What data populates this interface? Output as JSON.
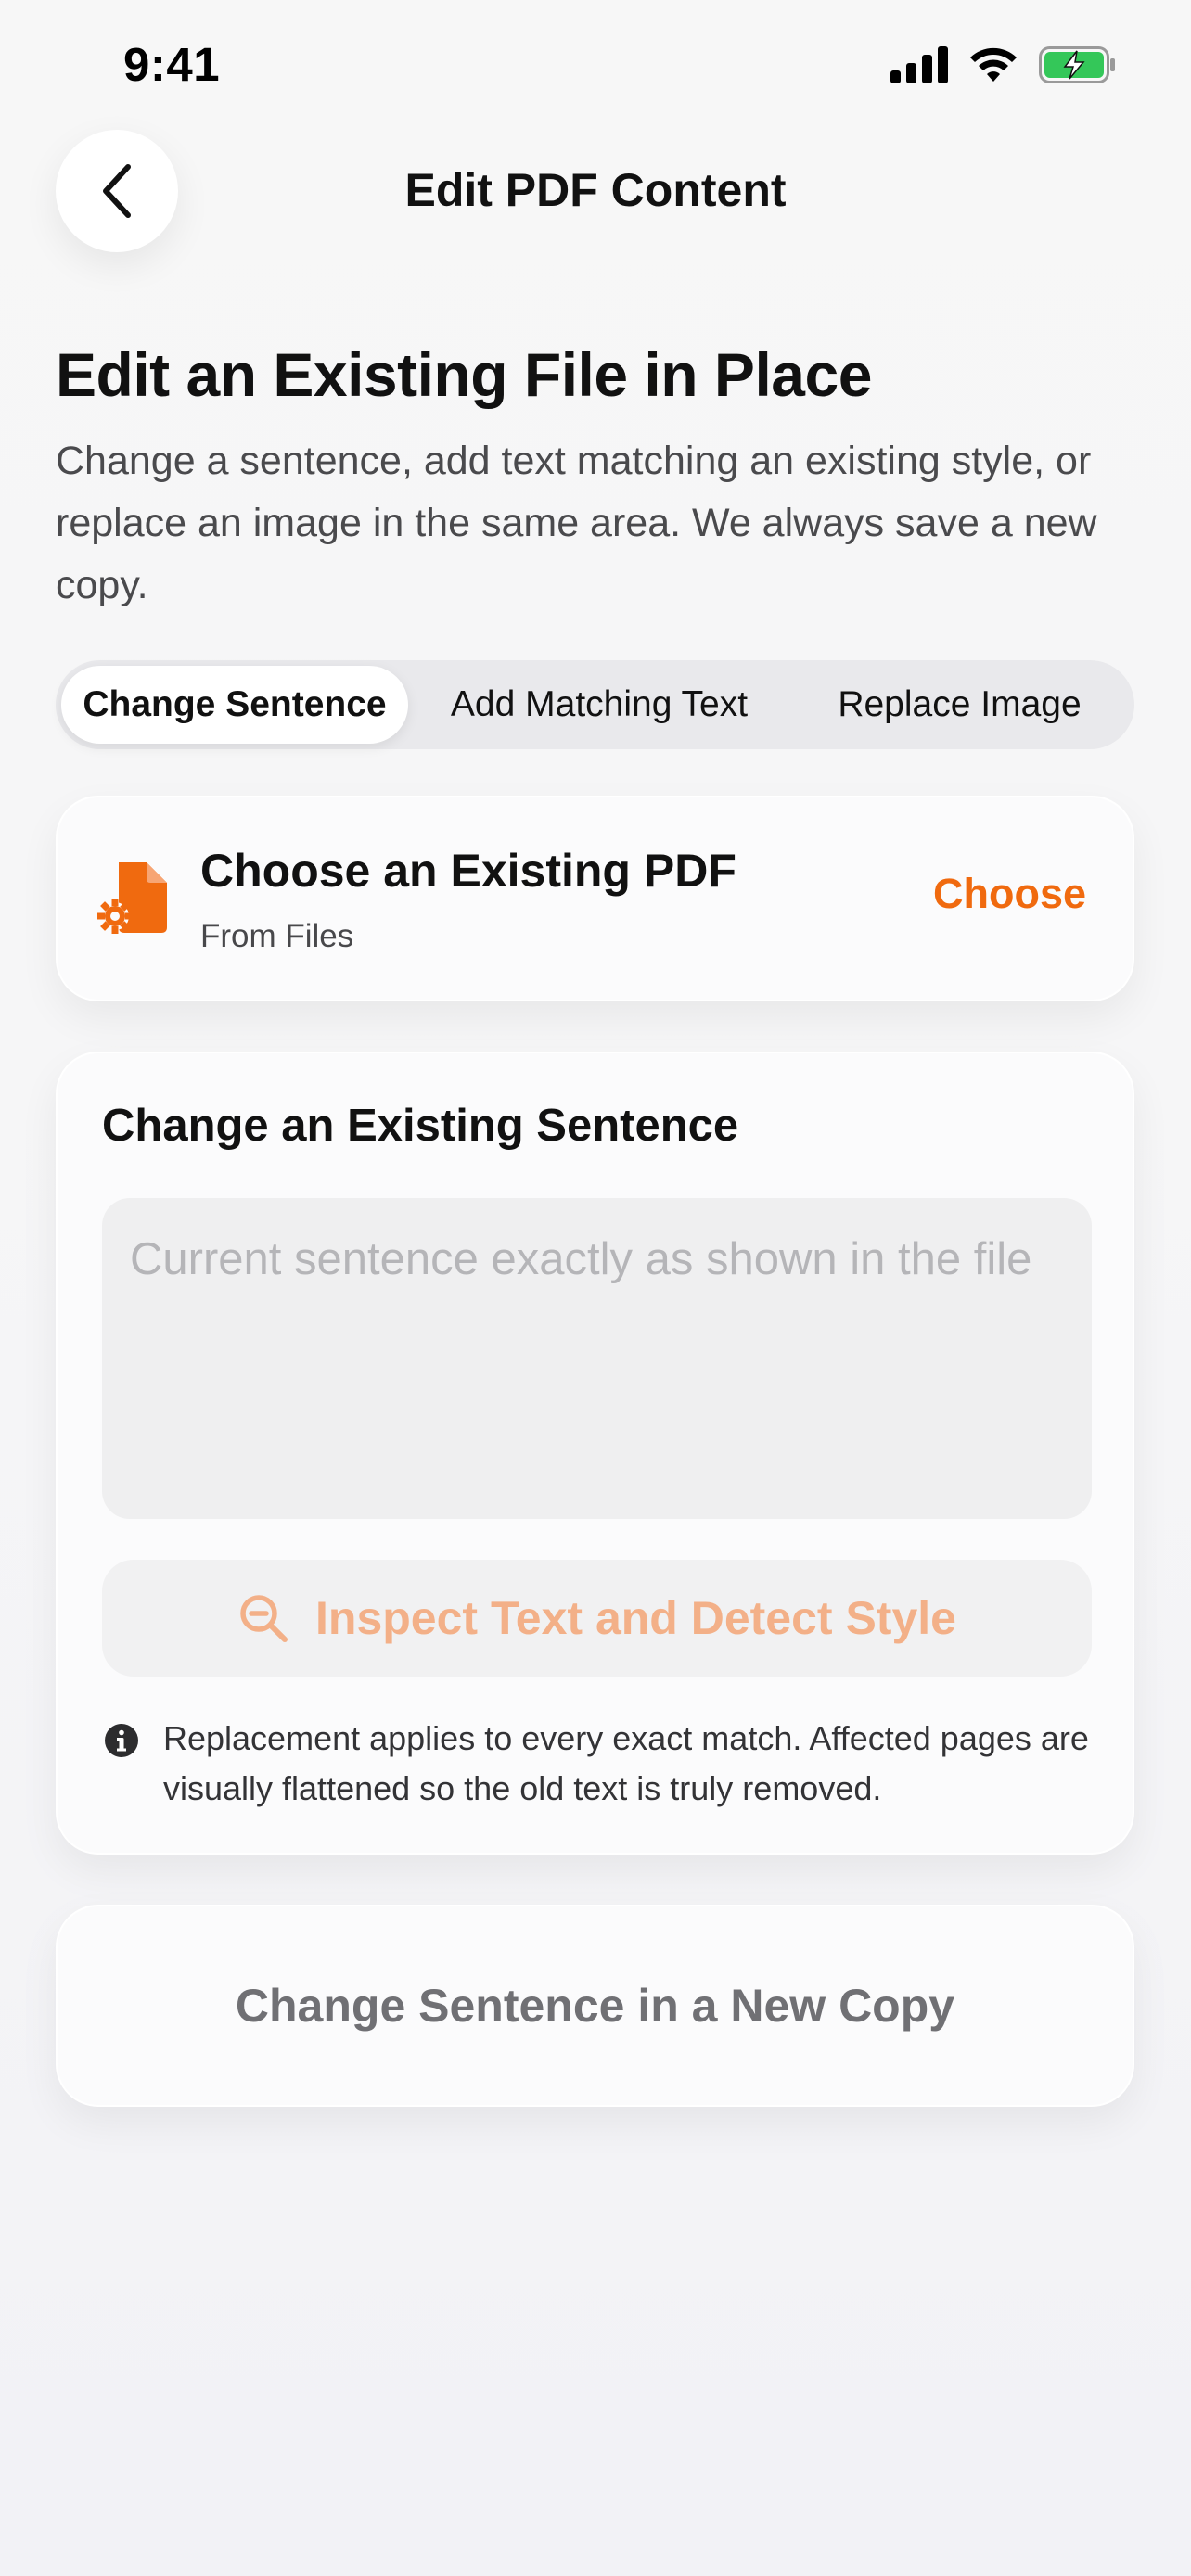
{
  "status_bar": {
    "time": "9:41",
    "icons": [
      "cellular-signal-icon",
      "wifi-icon",
      "battery-charging-icon"
    ],
    "battery_color": "#34c759"
  },
  "nav": {
    "back_icon": "chevron-left-icon",
    "title": "Edit PDF Content"
  },
  "header": {
    "title": "Edit an Existing File in Place",
    "subtitle": "Change a sentence, add text matching an existing style, or replace an image in the same area. We always save a new copy."
  },
  "tabs": [
    {
      "label": "Change Sentence",
      "selected": true
    },
    {
      "label": "Add Matching Text",
      "selected": false
    },
    {
      "label": "Replace Image",
      "selected": false
    }
  ],
  "file_picker": {
    "icon": "pdf-file-gear-icon",
    "title": "Choose an Existing PDF",
    "subtitle": "From Files",
    "action_label": "Choose",
    "accent_color": "#f06a0f"
  },
  "sentence_section": {
    "title": "Change an Existing Sentence",
    "input": {
      "value": "",
      "placeholder": "Current sentence exactly as shown in the file"
    },
    "inspect_button": {
      "icon": "magnifier-icon",
      "label": "Inspect Text and Detect Style"
    },
    "info": {
      "icon": "info-circle-icon",
      "text": "Replacement applies to every exact match. Affected pages are visually flattened so the old text is truly removed."
    }
  },
  "primary_action": {
    "label": "Change Sentence in a New Copy"
  }
}
